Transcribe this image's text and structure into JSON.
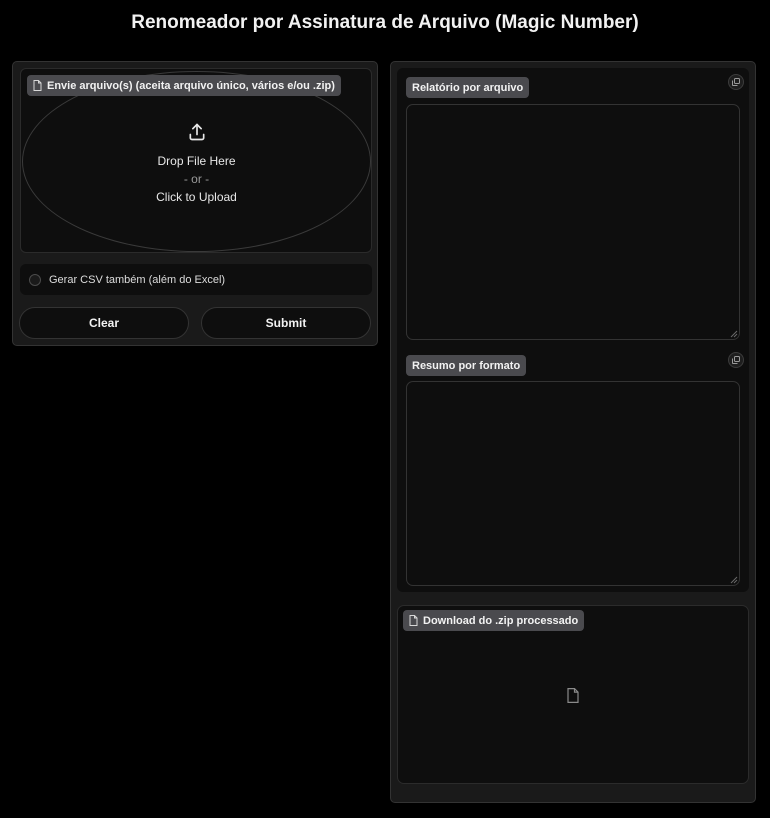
{
  "header": {
    "title": "Renomeador por Assinatura de Arquivo (Magic Number)"
  },
  "upload": {
    "label": "Envie arquivo(s) (aceita arquivo único, vários e/ou .zip)",
    "drop_text": "Drop File Here",
    "or_text": "- or -",
    "click_text": "Click to Upload",
    "icon": "upload-icon"
  },
  "options": {
    "csv_label": "Gerar CSV também (além do Excel)",
    "csv_checked": false
  },
  "actions": {
    "clear_label": "Clear",
    "submit_label": "Submit"
  },
  "outputs": {
    "report_label": "Relatório por arquivo",
    "report_value": "",
    "summary_label": "Resumo por formato",
    "summary_value": "",
    "download_label": "Download do .zip processado",
    "copy_icon": "copy-icon",
    "file_icon": "file-icon"
  },
  "colors": {
    "background": "#000000",
    "panel": "#1a1a1a",
    "block": "#0e0e0e",
    "badge": "#4a4a4e",
    "border": "#333333"
  }
}
